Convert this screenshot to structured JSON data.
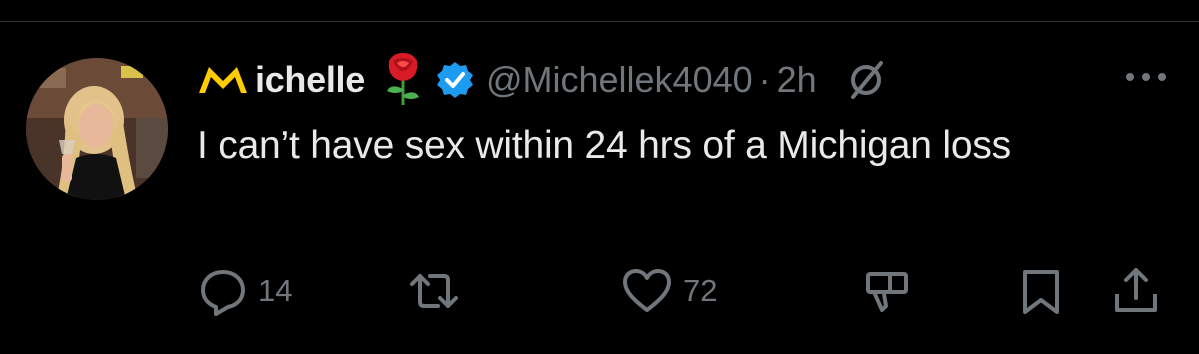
{
  "tweet": {
    "author": {
      "display_name_logo": "block-m-logo",
      "display_name": "ichelle",
      "emoji": "rose",
      "verified": true,
      "handle": "@Michellek4040",
      "separator": "·",
      "time": "2h"
    },
    "text": "I can’t have sex within 24 hrs of a Michigan loss",
    "actions": {
      "reply_count": "14",
      "retweet_count": "",
      "like_count": "72"
    }
  },
  "colors": {
    "background": "#000000",
    "text_primary": "#e7e9ea",
    "text_secondary": "#71767b",
    "verified_blue": "#1d9bf0",
    "michigan_maize": "#ffcb05"
  },
  "icons": {
    "more": "more-icon",
    "grok": "grok-icon",
    "reply": "reply-icon",
    "retweet": "retweet-icon",
    "like": "heart-icon",
    "dislike": "dislike-icon",
    "bookmark": "bookmark-icon",
    "share": "share-icon"
  }
}
